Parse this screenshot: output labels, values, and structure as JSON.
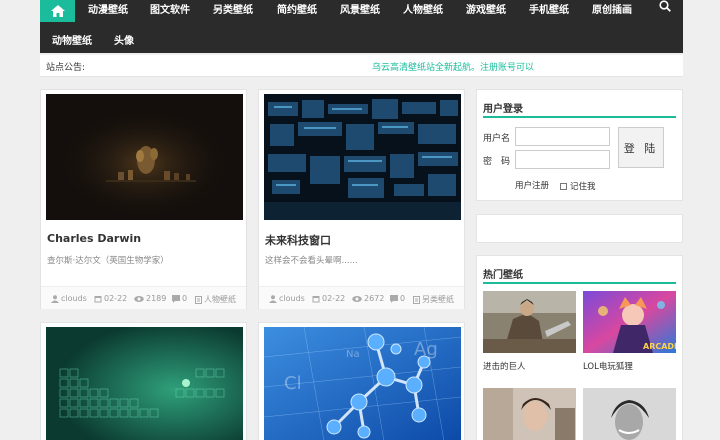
{
  "nav": {
    "items": [
      "动漫壁纸",
      "图文软件",
      "另类壁纸",
      "简约壁纸",
      "风景壁纸",
      "人物壁纸",
      "游戏壁纸",
      "手机壁纸",
      "原创插画",
      "动物壁纸",
      "头像"
    ],
    "home_icon": "home-icon",
    "search_icon": "search-icon"
  },
  "notice": {
    "label": "站点公告:",
    "text": "乌云高清壁纸站全新起航。注册账号可以"
  },
  "cards": [
    {
      "title": "Charles Darwin",
      "desc": "查尔斯·达尔文（英国生物学家）",
      "author": "clouds",
      "date": "02-22",
      "views": "2189",
      "comments": "0",
      "category": "人物壁纸"
    },
    {
      "title": "未来科技窗口",
      "desc": "这样会不会看头晕啊......",
      "author": "clouds",
      "date": "02-22",
      "views": "2672",
      "comments": "0",
      "category": "另类壁纸"
    },
    {
      "title": "",
      "desc": "",
      "author": "",
      "date": "",
      "views": "",
      "comments": "",
      "category": ""
    },
    {
      "title": "",
      "desc": "",
      "author": "",
      "date": "",
      "views": "",
      "comments": "",
      "category": ""
    }
  ],
  "login": {
    "title": "用户登录",
    "username_label": "用户名",
    "password_label": "密　码",
    "submit": "登 陆",
    "register": "用户注册",
    "remember": "记住我"
  },
  "hot": {
    "title": "热门壁纸",
    "items": [
      "进击的巨人",
      "LOL电玩狐狸",
      "",
      ""
    ],
    "overlay_text": "ARCADE"
  },
  "colors": {
    "accent": "#1abc9c",
    "nav_bg": "#2b2b2b",
    "page_bg": "#efefef"
  }
}
